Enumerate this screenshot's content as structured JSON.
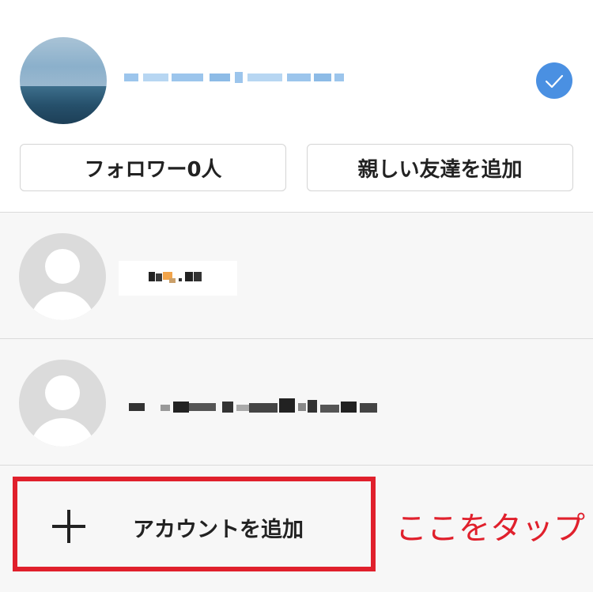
{
  "profile": {
    "followers_button_label": "フォロワー0人",
    "close_friends_button_label": "親しい友達を追加"
  },
  "accounts": [
    {
      "row": 1
    },
    {
      "row": 2
    }
  ],
  "add_account": {
    "label": "アカウントを追加",
    "icon": "plus-icon"
  },
  "annotation": {
    "text": "ここをタップ",
    "color": "#e0202c"
  },
  "colors": {
    "accent": "#4a90e2",
    "highlight_border": "#e0202c",
    "list_background": "#f7f7f7"
  }
}
